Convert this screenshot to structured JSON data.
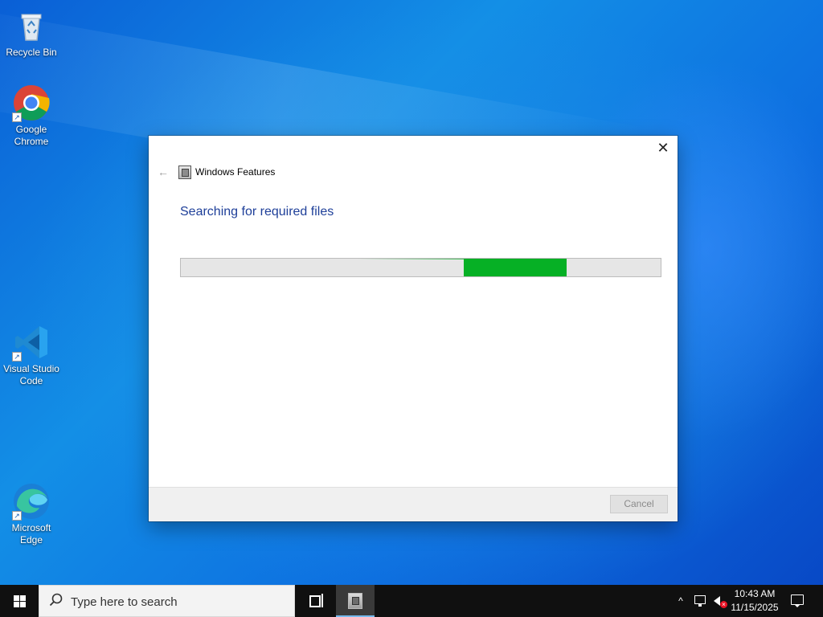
{
  "desktop": {
    "icons": [
      {
        "label": "Recycle Bin",
        "icon": "recycle-bin-icon"
      },
      {
        "label": "Google\nChrome",
        "icon": "chrome-icon"
      },
      {
        "label": "Visual Studio\nCode",
        "icon": "vscode-icon"
      },
      {
        "label": "Microsoft\nEdge",
        "icon": "edge-icon"
      }
    ]
  },
  "dialog": {
    "window_title": "Windows Features",
    "heading": "Searching for required files",
    "progress_state": "indeterminate",
    "cancel_label": "Cancel",
    "close_glyph": "✕",
    "back_glyph": "←"
  },
  "taskbar": {
    "search_placeholder": "Type here to search",
    "time": "10:43 AM",
    "date": "11/15/2025",
    "tray_chevron": "^"
  },
  "colors": {
    "progress": "#06b025",
    "heading": "#1e3f99",
    "taskbar": "#101010",
    "desktop": "#1283e3"
  }
}
